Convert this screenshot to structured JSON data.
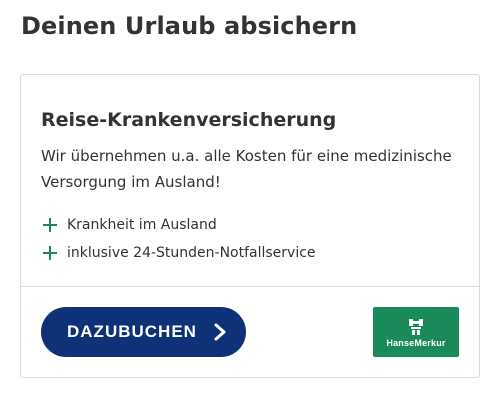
{
  "section": {
    "title": "Deinen Urlaub absichern"
  },
  "card": {
    "title": "Reise-Krankenversicherung",
    "description": "Wir übernehmen u.a. alle Kosten für eine medizinische Versorgung im Ausland!",
    "features": [
      {
        "icon": "plus-icon",
        "label": "Krankheit im Ausland"
      },
      {
        "icon": "plus-icon",
        "label": "inklusive 24-Stunden-Notfallservice"
      }
    ],
    "cta_label": "DAZUBUCHEN",
    "cta_icon": "chevron-right-icon",
    "logo_text": "HanseMerkur"
  },
  "colors": {
    "button": "#0f3178",
    "accent_green": "#1b8a5a",
    "text": "#333333",
    "border": "#dcdcdc"
  }
}
